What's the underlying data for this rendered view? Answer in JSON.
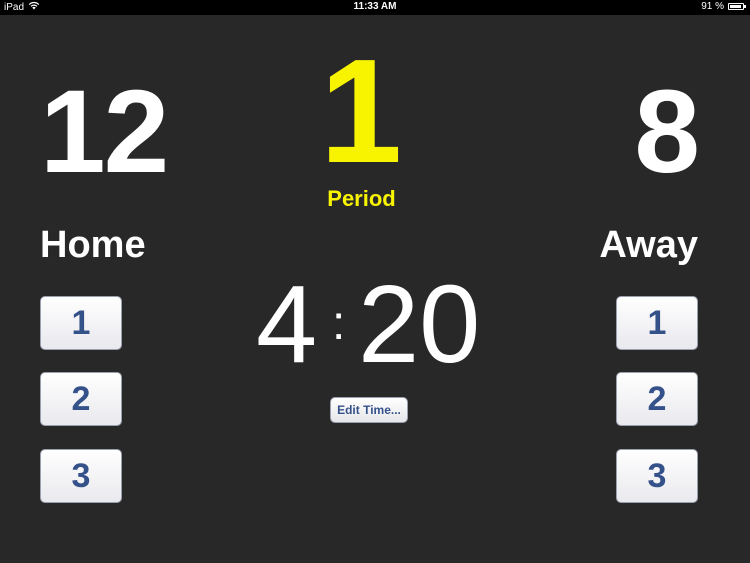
{
  "status_bar": {
    "device": "iPad",
    "time": "11:33 AM",
    "battery_text": "91 %",
    "battery_level": 0.91,
    "wifi_icon": "wifi-icon",
    "battery_icon": "battery-icon"
  },
  "home": {
    "score": "12",
    "name": "Home",
    "buttons": [
      "1",
      "2",
      "3"
    ]
  },
  "away": {
    "score": "8",
    "name": "Away",
    "buttons": [
      "1",
      "2",
      "3"
    ]
  },
  "period": {
    "number": "1",
    "label": "Period"
  },
  "clock": {
    "minutes": "4",
    "separator": ":",
    "seconds": "20",
    "edit_label": "Edit Time..."
  },
  "colors": {
    "background": "#282828",
    "period": "#f8f400",
    "button_text": "#35518a",
    "score": "#ffffff"
  }
}
